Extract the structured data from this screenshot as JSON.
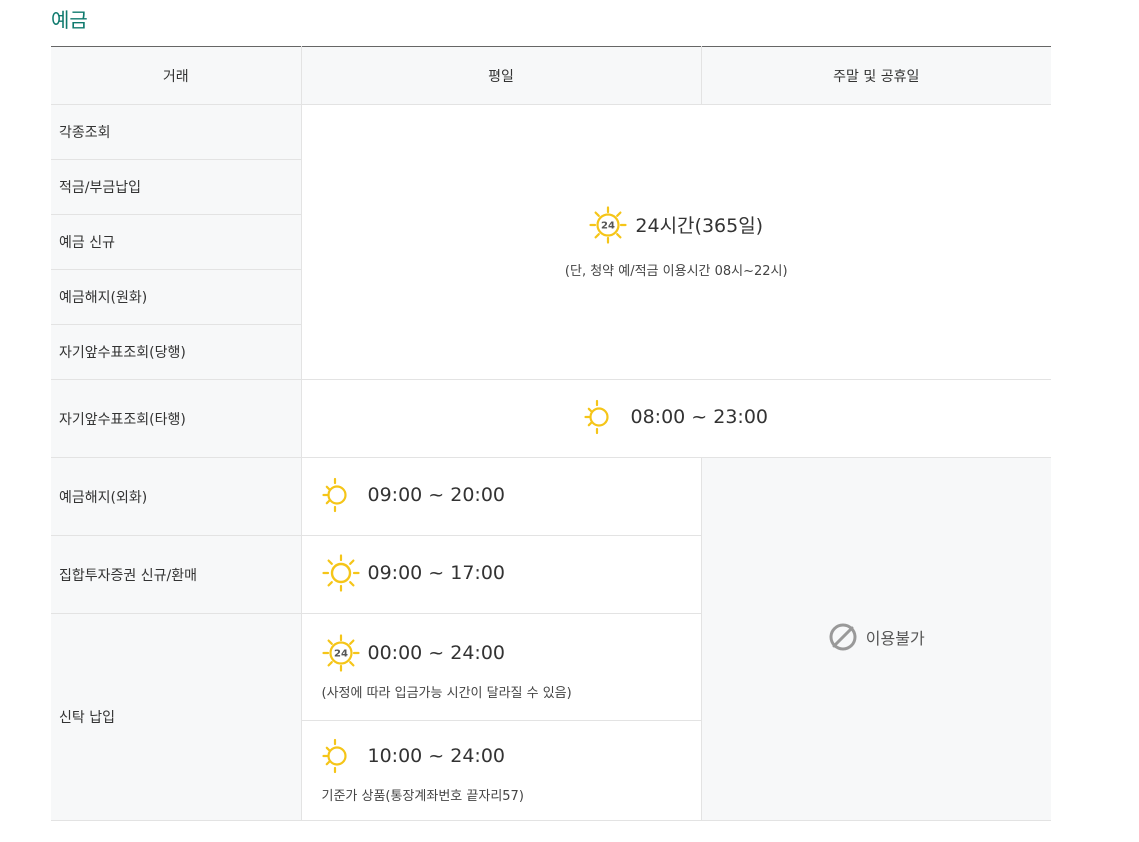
{
  "section_title": "예금",
  "headers": [
    "거래",
    "평일",
    "주말 및 공휴일"
  ],
  "rows_24h": [
    "각종조회",
    "적금/부금납입",
    "예금 신규",
    "예금해지(원화)",
    "자기앞수표조회(당행)"
  ],
  "all_day": {
    "time": "24시간(365일)",
    "note": "(단, 청약 예/적금 이용시간 08시~22시)"
  },
  "other_bank_check": {
    "label": "자기앞수표조회(타행)",
    "time": "08:00 ~ 23:00"
  },
  "foreign_withdraw": {
    "label": "예금해지(외화)",
    "time": "09:00 ~ 20:00"
  },
  "fund": {
    "label": "집합투자증권 신규/환매",
    "time": "09:00 ~ 17:00"
  },
  "trust": {
    "label": "신탁 납입",
    "time1": "00:00 ~ 24:00",
    "note1": "(사정에 따라 입금가능 시간이 달라질 수 있음)",
    "time2": "10:00 ~ 24:00",
    "note2": "기준가 상품(통장계좌번호 끝자리57)"
  },
  "weekend_unavailable": "이용불가",
  "icons": {
    "sun24": "sun-24-icon",
    "sun_moon": "sun-moon-icon",
    "sun": "sun-icon",
    "unavailable": "no-entry-icon"
  },
  "colors": {
    "title": "#0f7a6e",
    "sun": "#f5c518",
    "moon": "#5cc6b7",
    "unavailable": "#999999"
  }
}
